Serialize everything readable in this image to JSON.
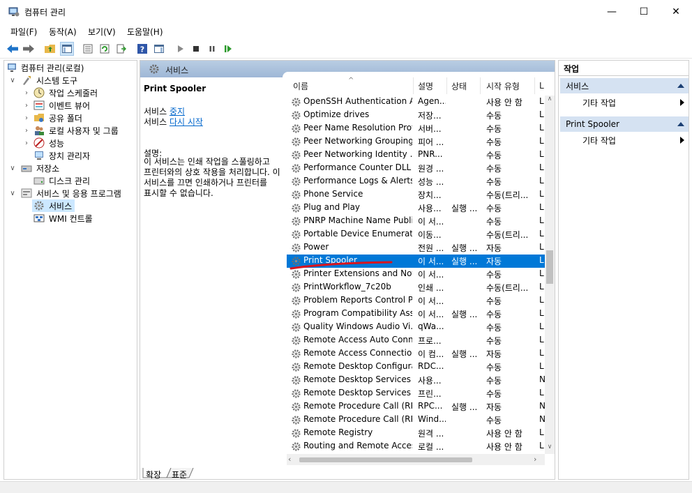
{
  "window": {
    "title": "컴퓨터 관리",
    "minimize": "—",
    "maximize": "☐",
    "close": "✕"
  },
  "menu": [
    "파일(F)",
    "동작(A)",
    "보기(V)",
    "도움말(H)"
  ],
  "tree": {
    "root": "컴퓨터 관리(로컬)",
    "system_tools": "시스템 도구",
    "task_scheduler": "작업 스케줄러",
    "event_viewer": "이벤트 뷰어",
    "shared_folders": "공유 폴더",
    "local_users": "로컬 사용자 및 그룹",
    "performance": "성능",
    "device_manager": "장치 관리자",
    "storage": "저장소",
    "disk_management": "디스크 관리",
    "services_apps": "서비스 및 응용 프로그램",
    "services": "서비스",
    "wmi": "WMI 컨트롤"
  },
  "middle": {
    "header": "서비스",
    "selected_name": "Print Spooler",
    "service_prefix": "서비스",
    "stop_link": "중지",
    "restart_link": "다시 시작",
    "desc_label": "설명:",
    "desc_text": "이 서비스는 인쇄 작업을 스풀링하고 프린터와의 상호 작용을 처리합니다. 이 서비스를 끄면 인쇄하거나 프린터를 표시할 수 없습니다."
  },
  "columns": {
    "name": "이름",
    "description": "설명",
    "status": "상태",
    "startup": "시작 유형",
    "logon": "L"
  },
  "services": [
    {
      "name": "OpenSSH Authentication A...",
      "desc": "Agen...",
      "status": "",
      "startup": "사용 안 함",
      "logon": "L"
    },
    {
      "name": "Optimize drives",
      "desc": "저장...",
      "status": "",
      "startup": "수동",
      "logon": "L"
    },
    {
      "name": "Peer Name Resolution Prot...",
      "desc": "서버...",
      "status": "",
      "startup": "수동",
      "logon": "L"
    },
    {
      "name": "Peer Networking Grouping",
      "desc": "피어 ...",
      "status": "",
      "startup": "수동",
      "logon": "L"
    },
    {
      "name": "Peer Networking Identity ...",
      "desc": "PNR...",
      "status": "",
      "startup": "수동",
      "logon": "L"
    },
    {
      "name": "Performance Counter DLL ...",
      "desc": "원경 ...",
      "status": "",
      "startup": "수동",
      "logon": "L"
    },
    {
      "name": "Performance Logs & Alerts",
      "desc": "성능 ...",
      "status": "",
      "startup": "수동",
      "logon": "L"
    },
    {
      "name": "Phone Service",
      "desc": "장치...",
      "status": "",
      "startup": "수동(트리...",
      "logon": "L"
    },
    {
      "name": "Plug and Play",
      "desc": "사용...",
      "status": "실행 ...",
      "startup": "수동",
      "logon": "L"
    },
    {
      "name": "PNRP Machine Name Publi...",
      "desc": "이 서...",
      "status": "",
      "startup": "수동",
      "logon": "L"
    },
    {
      "name": "Portable Device Enumerato...",
      "desc": "이동...",
      "status": "",
      "startup": "수동(트리...",
      "logon": "L"
    },
    {
      "name": "Power",
      "desc": "전원 ...",
      "status": "실행 ...",
      "startup": "자동",
      "logon": "L"
    },
    {
      "name": "Print Spooler",
      "desc": "이 서...",
      "status": "실행 ...",
      "startup": "자동",
      "logon": "L",
      "selected": true
    },
    {
      "name": "Printer Extensions and Noti...",
      "desc": "이 서...",
      "status": "",
      "startup": "수동",
      "logon": "L"
    },
    {
      "name": "PrintWorkflow_7c20b",
      "desc": "인쇄 ...",
      "status": "",
      "startup": "수동(트리...",
      "logon": "L"
    },
    {
      "name": "Problem Reports Control P...",
      "desc": "이 서...",
      "status": "",
      "startup": "수동",
      "logon": "L"
    },
    {
      "name": "Program Compatibility Assi...",
      "desc": "이 서...",
      "status": "실행 ...",
      "startup": "수동",
      "logon": "L"
    },
    {
      "name": "Quality Windows Audio Vi...",
      "desc": "qWa...",
      "status": "",
      "startup": "수동",
      "logon": "L"
    },
    {
      "name": "Remote Access Auto Conn...",
      "desc": "프로...",
      "status": "",
      "startup": "수동",
      "logon": "L"
    },
    {
      "name": "Remote Access Connection...",
      "desc": "이 컴...",
      "status": "실행 ...",
      "startup": "자동",
      "logon": "L"
    },
    {
      "name": "Remote Desktop Configura...",
      "desc": "RDC...",
      "status": "",
      "startup": "수동",
      "logon": "L"
    },
    {
      "name": "Remote Desktop Services",
      "desc": "사용...",
      "status": "",
      "startup": "수동",
      "logon": "N"
    },
    {
      "name": "Remote Desktop Services ...",
      "desc": "프린...",
      "status": "",
      "startup": "수동",
      "logon": "L"
    },
    {
      "name": "Remote Procedure Call (RP...",
      "desc": "RPC...",
      "status": "실행 ...",
      "startup": "자동",
      "logon": "N"
    },
    {
      "name": "Remote Procedure Call (RP...",
      "desc": "Wind...",
      "status": "",
      "startup": "수동",
      "logon": "N"
    },
    {
      "name": "Remote Registry",
      "desc": "원격 ...",
      "status": "",
      "startup": "사용 안 함",
      "logon": "L"
    },
    {
      "name": "Routing and Remote Access",
      "desc": "로컬 ...",
      "status": "",
      "startup": "사용 안 함",
      "logon": "L"
    }
  ],
  "tabs": {
    "extended": "확장",
    "standard": "표준"
  },
  "actions": {
    "title": "작업",
    "section1": "서비스",
    "section1_more": "기타 작업",
    "section2": "Print Spooler",
    "section2_more": "기타 작업"
  },
  "colors": {
    "selection": "#0078d7",
    "link": "#0066cc",
    "annotation": "#d9141e",
    "header_gradient": "#a9c2df"
  }
}
